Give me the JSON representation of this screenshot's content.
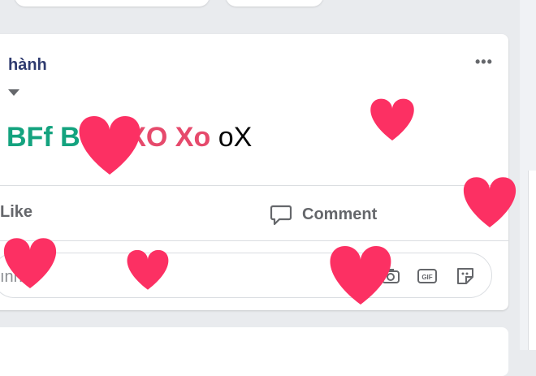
{
  "post": {
    "author_fragment": "hành",
    "text_segments": [
      {
        "text": "BFf B",
        "color": "#14a37f"
      },
      {
        "text": "xo XO Xo",
        "color": "#e64a6c"
      },
      {
        "text": "oX",
        "color": "#050505"
      }
    ]
  },
  "actions": {
    "like_label": "Like",
    "comment_label": "Comment"
  },
  "comment_box": {
    "placeholder": "ınh..."
  },
  "icons": [
    "dropdown-caret-icon",
    "more-icon",
    "comment-icon",
    "camera-icon",
    "gif-icon",
    "sticker-icon",
    "heart-icon"
  ],
  "colors": {
    "heart": "#fc3063",
    "author": "#2f3b6f",
    "muted": "#65676b"
  }
}
